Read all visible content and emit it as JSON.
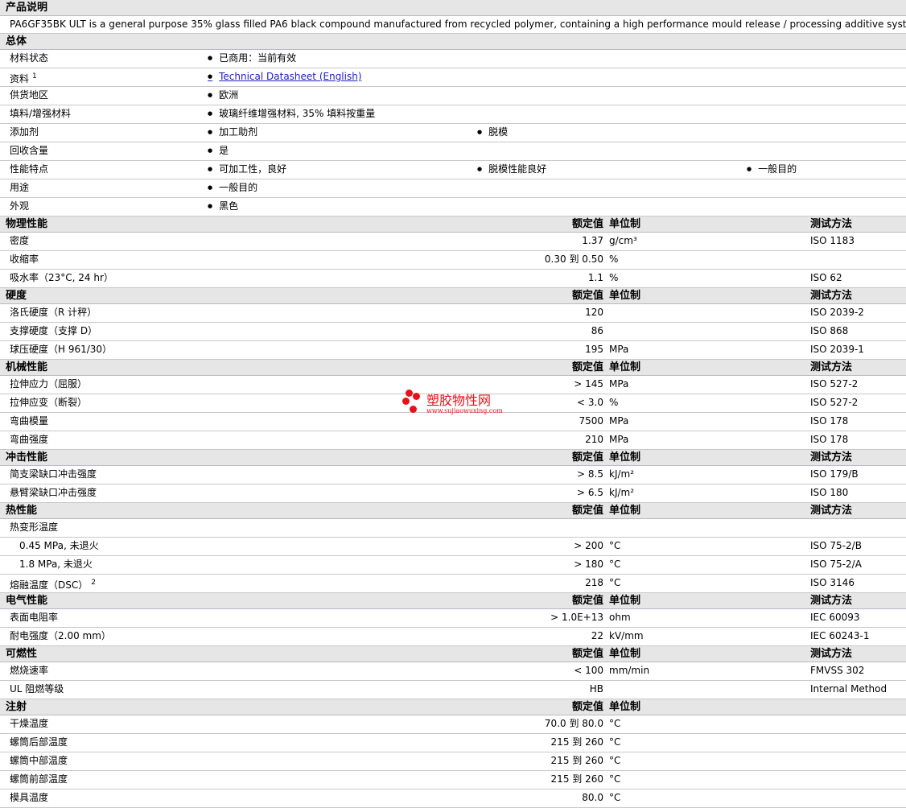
{
  "description_header": "产品说明",
  "description": "PA6GF35BK ULT is a general purpose 35% glass filled PA6 black compound manufactured from recycled polymer, containing a high performance mould release / processing additive system.",
  "general": {
    "title": "总体",
    "rows": [
      {
        "label": "材料状态",
        "items": [
          "已商用：当前有效"
        ]
      },
      {
        "label": "资料",
        "sup": "1",
        "items": [
          "Technical Datasheet (English)"
        ],
        "link": true
      },
      {
        "label": "供货地区",
        "items": [
          "欧洲"
        ]
      },
      {
        "label": "填料/增强材料",
        "items": [
          "玻璃纤维增强材料, 35% 填料按重量"
        ]
      },
      {
        "label": "添加剂",
        "items": [
          "加工助剂",
          "脱模"
        ]
      },
      {
        "label": "回收含量",
        "items": [
          "是"
        ]
      },
      {
        "label": "性能特点",
        "items": [
          "可加工性，良好",
          "脱模性能良好",
          "一般目的"
        ]
      },
      {
        "label": "用途",
        "items": [
          "一般目的"
        ]
      },
      {
        "label": "外观",
        "items": [
          "黑色"
        ]
      }
    ]
  },
  "col_headers": {
    "value": "额定值",
    "unit": "单位制",
    "test": "测试方法"
  },
  "sections": [
    {
      "title": "物理性能",
      "test_col": true,
      "rows": [
        {
          "label": "密度",
          "value": "1.37",
          "unit": "g/cm³",
          "test": "ISO 1183"
        },
        {
          "label": "收缩率",
          "value": "0.30 到  0.50",
          "unit": "%",
          "test": ""
        },
        {
          "label": "吸水率（23°C, 24 hr）",
          "value": "1.1",
          "unit": "%",
          "test": "ISO 62"
        }
      ]
    },
    {
      "title": "硬度",
      "test_col": true,
      "rows": [
        {
          "label": "洛氏硬度（R 计秤）",
          "value": "120",
          "unit": "",
          "test": "ISO 2039-2"
        },
        {
          "label": "支撑硬度（支撑 D）",
          "value": "86",
          "unit": "",
          "test": "ISO 868"
        },
        {
          "label": "球压硬度（H 961/30）",
          "value": "195",
          "unit": "MPa",
          "test": "ISO 2039-1"
        }
      ]
    },
    {
      "title": "机械性能",
      "test_col": true,
      "rows": [
        {
          "label": "拉伸应力（屈服）",
          "value": "> 145",
          "unit": "MPa",
          "test": "ISO 527-2"
        },
        {
          "label": "拉伸应变（断裂）",
          "value": "< 3.0",
          "unit": "%",
          "test": "ISO 527-2"
        },
        {
          "label": "弯曲模量",
          "value": "7500",
          "unit": "MPa",
          "test": "ISO 178"
        },
        {
          "label": "弯曲强度",
          "value": "210",
          "unit": "MPa",
          "test": "ISO 178"
        }
      ]
    },
    {
      "title": "冲击性能",
      "test_col": true,
      "rows": [
        {
          "label": "简支梁缺口冲击强度",
          "value": "> 8.5",
          "unit": "kJ/m²",
          "test": "ISO 179/B"
        },
        {
          "label": "悬臂梁缺口冲击强度",
          "value": "> 6.5",
          "unit": "kJ/m²",
          "test": "ISO 180"
        }
      ]
    },
    {
      "title": "热性能",
      "test_col": true,
      "rows": [
        {
          "label": "热变形温度",
          "value": "",
          "unit": "",
          "test": ""
        },
        {
          "label": "0.45 MPa, 未退火",
          "indent": true,
          "value": "> 200",
          "unit": "°C",
          "test": "ISO 75-2/B"
        },
        {
          "label": "1.8 MPa, 未退火",
          "indent": true,
          "value": "> 180",
          "unit": "°C",
          "test": "ISO 75-2/A"
        },
        {
          "label": "熔融温度（DSC）",
          "sup": "2",
          "value": "218",
          "unit": "°C",
          "test": "ISO 3146"
        }
      ]
    },
    {
      "title": "电气性能",
      "test_col": true,
      "rows": [
        {
          "label": "表面电阻率",
          "value": "> 1.0E+13",
          "unit": "ohm",
          "test": "IEC 60093"
        },
        {
          "label": "耐电强度（2.00 mm）",
          "value": "22",
          "unit": "kV/mm",
          "test": "IEC 60243-1"
        }
      ]
    },
    {
      "title": "可燃性",
      "test_col": true,
      "rows": [
        {
          "label": "燃烧速率",
          "value": "< 100",
          "unit": "mm/min",
          "test": "FMVSS 302"
        },
        {
          "label": "UL 阻燃等级",
          "value": "HB",
          "unit": "",
          "test": "Internal Method"
        }
      ]
    },
    {
      "title": "注射",
      "test_col": false,
      "rows": [
        {
          "label": "干燥温度",
          "value": "70.0 到  80.0",
          "unit": "°C",
          "test": ""
        },
        {
          "label": "螺筒后部温度",
          "value": "215 到  260",
          "unit": "°C",
          "test": ""
        },
        {
          "label": "螺筒中部温度",
          "value": "215 到  260",
          "unit": "°C",
          "test": ""
        },
        {
          "label": "螺筒前部温度",
          "value": "215 到  260",
          "unit": "°C",
          "test": ""
        },
        {
          "label": "模具温度",
          "value": "80.0",
          "unit": "°C",
          "test": ""
        }
      ]
    }
  ],
  "watermark": {
    "title": "塑胶物性网",
    "url": "www.sujiaowuxing.com"
  },
  "colors": {
    "header_bg": "#e6e6e6",
    "link": "#2020c0",
    "watermark": "#e8101a"
  }
}
